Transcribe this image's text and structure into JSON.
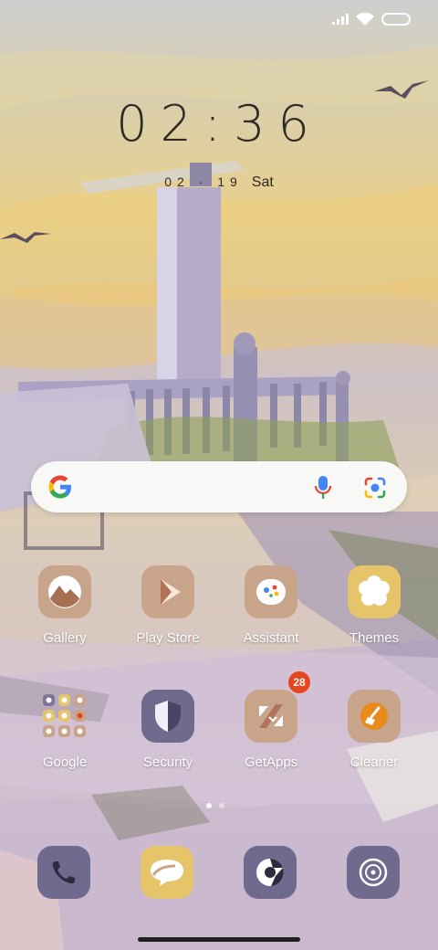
{
  "status": {
    "icons": [
      "signal-icon",
      "wifi-icon",
      "battery-icon"
    ]
  },
  "clock": {
    "time": "02:36",
    "date": "02 · 19",
    "weekday": "Sat"
  },
  "search": {
    "icons": [
      "google-logo-icon",
      "mic-icon",
      "lens-icon"
    ]
  },
  "apps": {
    "gallery": "Gallery",
    "play_store": "Play Store",
    "assistant": "Assistant",
    "themes": "Themes",
    "google": "Google",
    "security": "Security",
    "getapps": "GetApps",
    "getapps_badge": "28",
    "cleaner": "Cleaner"
  },
  "dock": {
    "icons": [
      "phone-icon",
      "messages-icon",
      "browser-icon",
      "camera-icon"
    ]
  },
  "pager": {
    "pages": 2,
    "current": 1
  },
  "colors": {
    "icon_tan": "#c8a58a",
    "icon_purple": "#6f6a8e",
    "icon_yellow": "#e6c46a",
    "badge": "#e6451e"
  }
}
